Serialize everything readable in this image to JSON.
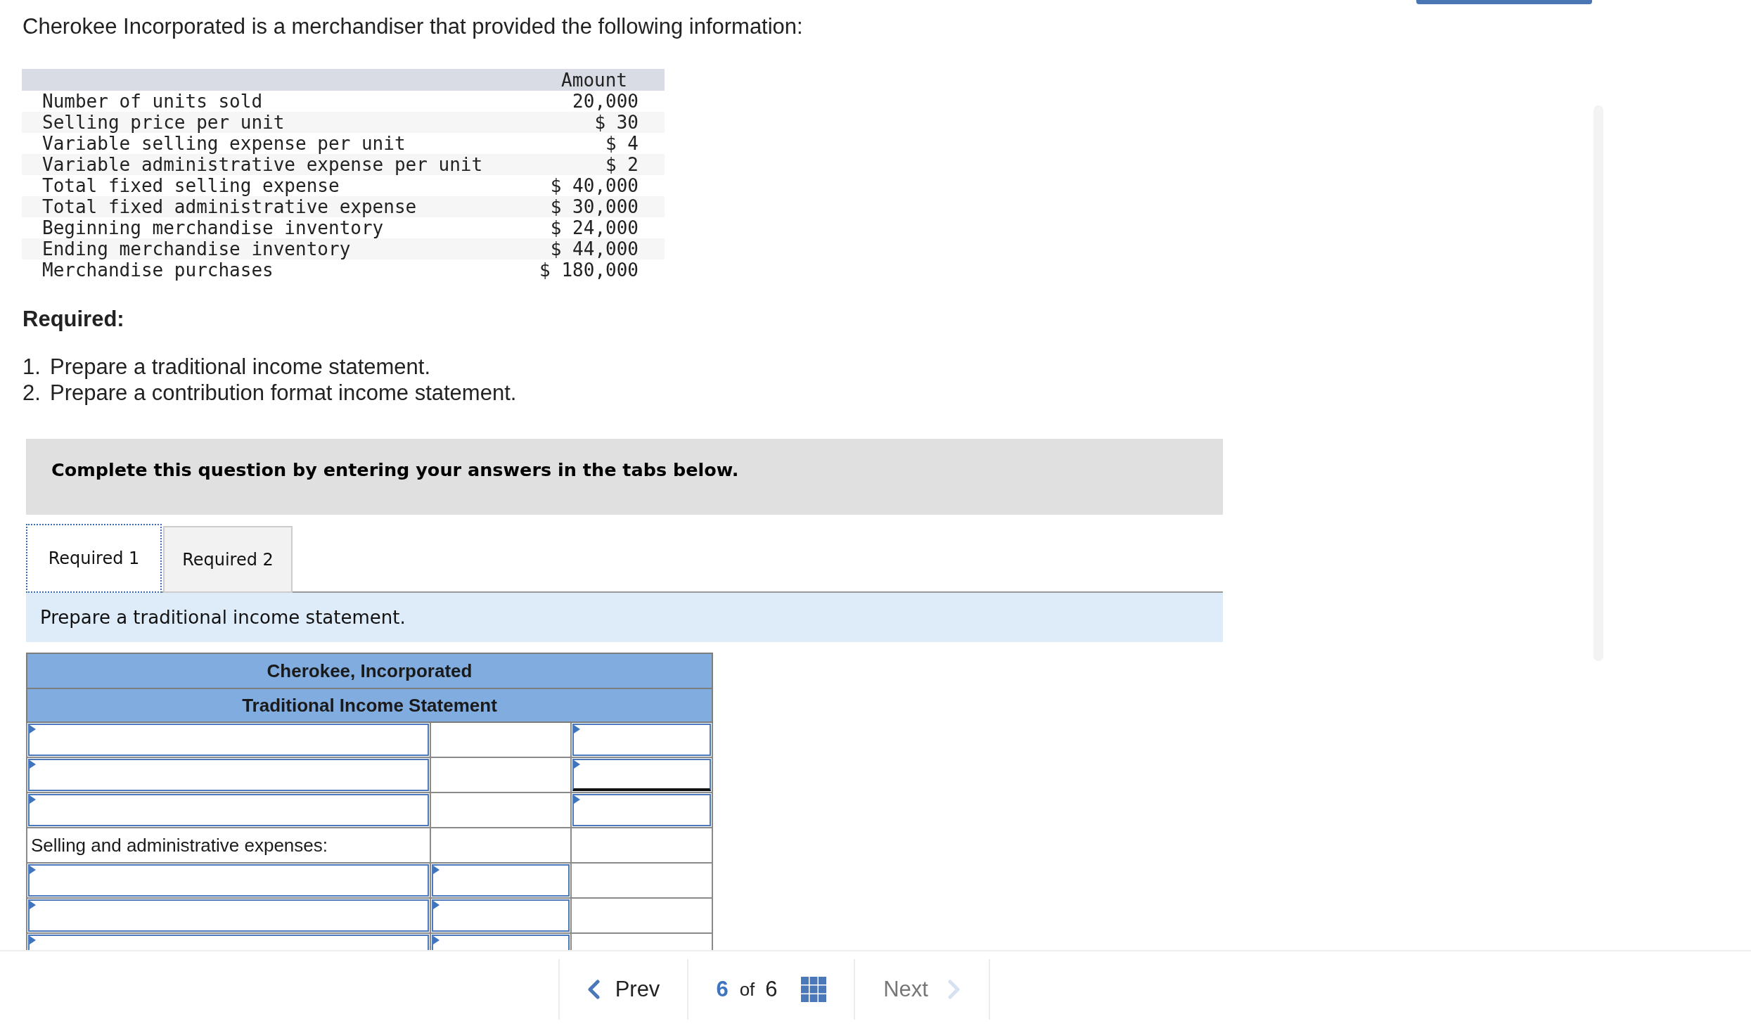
{
  "intro": "Cherokee Incorporated is a merchandiser that provided the following information:",
  "data_table": {
    "column_header": "Amount",
    "rows": [
      {
        "label": "Number of units sold",
        "amount": "20,000"
      },
      {
        "label": "Selling price per unit",
        "amount": "$ 30"
      },
      {
        "label": "Variable selling expense per unit",
        "amount": "$ 4"
      },
      {
        "label": "Variable administrative expense per unit",
        "amount": "$ 2"
      },
      {
        "label": "Total fixed selling expense",
        "amount": "$ 40,000"
      },
      {
        "label": "Total fixed administrative expense",
        "amount": "$ 30,000"
      },
      {
        "label": "Beginning merchandise inventory",
        "amount": "$ 24,000"
      },
      {
        "label": "Ending merchandise inventory",
        "amount": "$ 44,000"
      },
      {
        "label": "Merchandise purchases",
        "amount": "$ 180,000"
      }
    ]
  },
  "required": {
    "heading": "Required:",
    "items": [
      {
        "number": "1.",
        "text": "Prepare a traditional income statement."
      },
      {
        "number": "2.",
        "text": "Prepare a contribution format income statement."
      }
    ]
  },
  "instruction": "Complete this question by entering your answers in the tabs below.",
  "tabs": [
    {
      "label": "Required 1",
      "selected": true
    },
    {
      "label": "Required 2",
      "selected": false
    }
  ],
  "tab_prompt": "Prepare a traditional income statement.",
  "statement": {
    "title": "Cherokee, Incorporated",
    "subtitle": "Traditional Income Statement",
    "rows": [
      {
        "cells": [
          {
            "kind": "input"
          },
          {
            "kind": "empty"
          },
          {
            "kind": "input"
          }
        ]
      },
      {
        "cells": [
          {
            "kind": "input"
          },
          {
            "kind": "empty"
          },
          {
            "kind": "input",
            "rule_below": true
          }
        ]
      },
      {
        "cells": [
          {
            "kind": "input"
          },
          {
            "kind": "empty"
          },
          {
            "kind": "input"
          }
        ]
      },
      {
        "cells": [
          {
            "kind": "text",
            "text": "Selling and administrative expenses:"
          },
          {
            "kind": "empty"
          },
          {
            "kind": "empty"
          }
        ]
      },
      {
        "cells": [
          {
            "kind": "input"
          },
          {
            "kind": "input"
          },
          {
            "kind": "empty"
          }
        ]
      },
      {
        "cells": [
          {
            "kind": "input"
          },
          {
            "kind": "input"
          },
          {
            "kind": "empty"
          }
        ]
      },
      {
        "cells": [
          {
            "kind": "input"
          },
          {
            "kind": "input"
          },
          {
            "kind": "empty"
          }
        ]
      }
    ]
  },
  "pager": {
    "prev": {
      "label": "Prev",
      "disabled": false
    },
    "position": {
      "current": "6",
      "separator": "of",
      "total": "6"
    },
    "next": {
      "label": "Next",
      "disabled": true
    }
  }
}
